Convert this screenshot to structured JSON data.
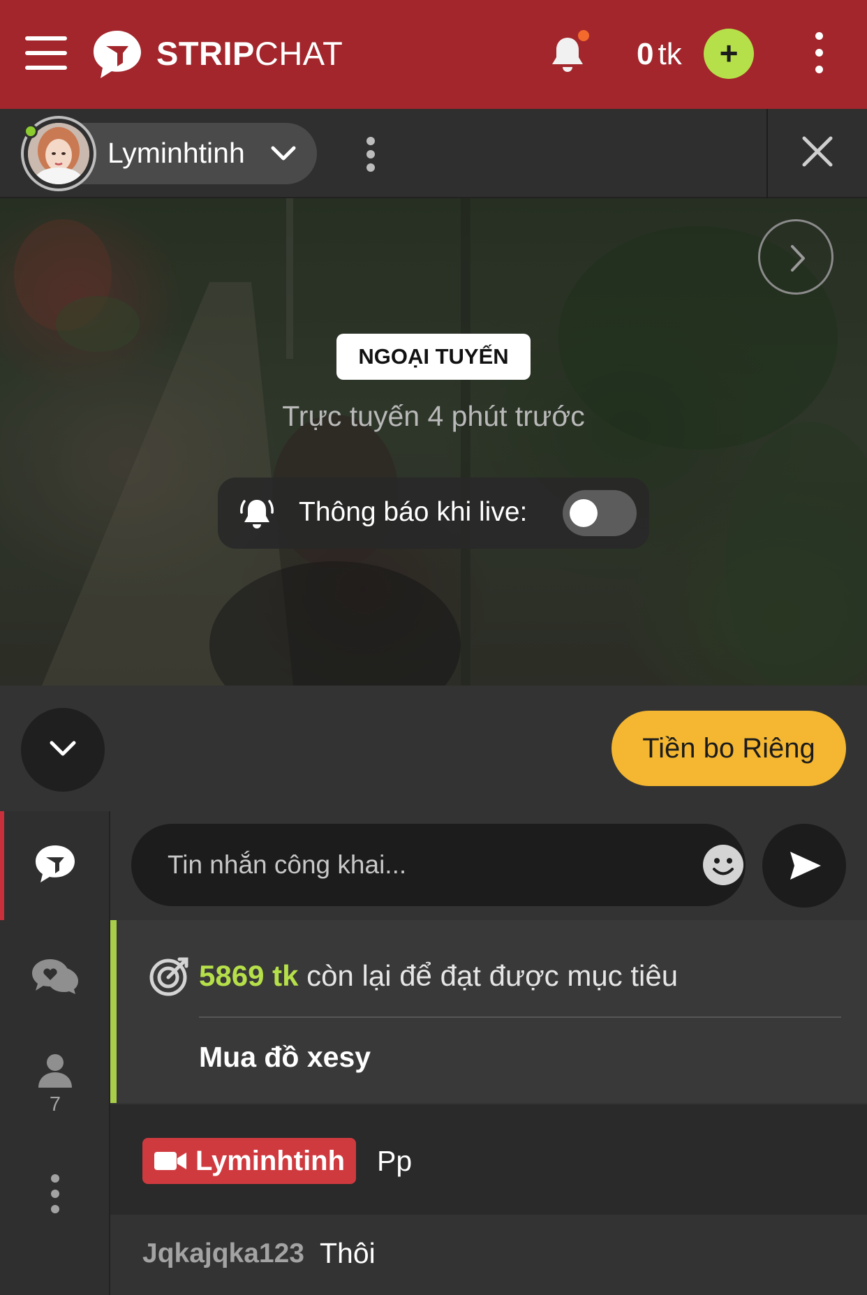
{
  "topbar": {
    "brand_strong": "STRIP",
    "brand_light": "CHAT",
    "token_count": "0",
    "token_unit": "tk",
    "add_label": "+",
    "icons": [
      "menu-icon",
      "logo-icon",
      "bell-icon",
      "more-vertical-icon"
    ],
    "colors": {
      "bar": "#a2262b",
      "add": "#b6e04a",
      "notification_dot": "#f36a2c"
    }
  },
  "model": {
    "name": "Lyminhtinh",
    "online": true,
    "icons": [
      "avatar",
      "chevron-down-icon",
      "more-vertical-icon",
      "close-icon"
    ]
  },
  "video": {
    "status_badge": "NGOẠI TUYẾN",
    "last_online": "Trực tuyến 4 phút trước",
    "notify_label": "Thông báo khi live:",
    "notify_enabled": false,
    "icons": [
      "chevron-right-icon",
      "bell-ringing-icon"
    ]
  },
  "controls": {
    "private_tip_label": "Tiền bo Riêng",
    "icons": [
      "chevron-down-icon"
    ],
    "colors": {
      "tip": "#f5b731"
    }
  },
  "sidebar": {
    "items": [
      {
        "name": "public-chat",
        "icon": "chat-bubble-icon",
        "active": true
      },
      {
        "name": "private-messages",
        "icon": "chat-bubbles-icon"
      },
      {
        "name": "users",
        "icon": "user-icon",
        "count": "7"
      },
      {
        "name": "more",
        "icon": "more-vertical-icon"
      }
    ]
  },
  "chat": {
    "input_placeholder": "Tin nhắn công khai...",
    "icons": [
      "emoji-icon",
      "send-icon"
    ],
    "goal": {
      "amount": "5869 tk",
      "remaining_text": "còn lại để đạt được mục tiêu",
      "title": "Mua đồ xesy",
      "icon": "target-icon",
      "accent": "#a9cf4a"
    },
    "messages": [
      {
        "user": "Lyminhtinh",
        "is_model": true,
        "text": "Pp",
        "icon": "video-camera-icon",
        "badge_color": "#cf3a3f"
      },
      {
        "user": "Jqkajqka123",
        "is_model": false,
        "text": "Thôi"
      }
    ]
  }
}
